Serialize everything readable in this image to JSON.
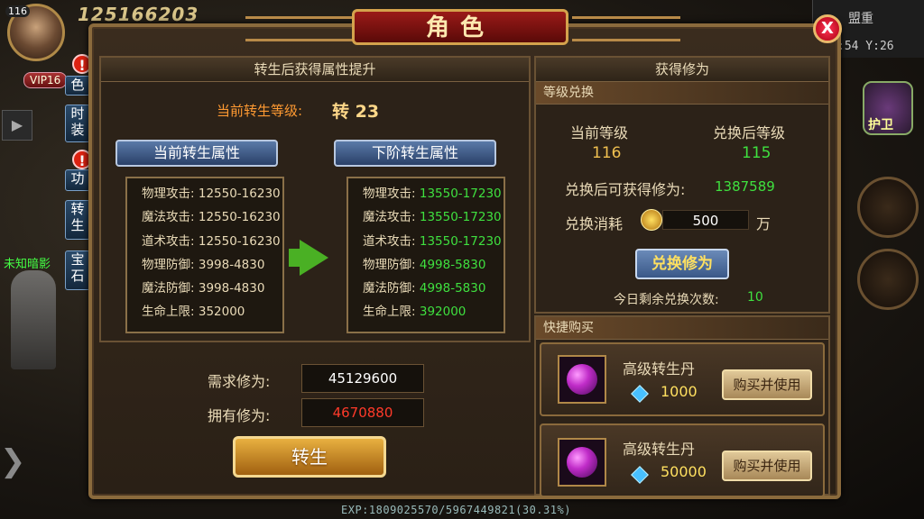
{
  "hud": {
    "player_level": "116",
    "vip": "VIP16",
    "power_value": "125166203",
    "side_tabs": [
      {
        "label": "色",
        "alert": "!"
      },
      {
        "label": "时装",
        "alert": ""
      },
      {
        "label": "功",
        "alert": "!"
      },
      {
        "label": "转生",
        "alert": ""
      },
      {
        "label": "宝石",
        "alert": ""
      }
    ],
    "npc_name": "未知暗影",
    "union": "盟重",
    "coords": ":54 Y:26",
    "guard_label": "护卫",
    "exp": "EXP:1809025570/5967449821(30.31%)"
  },
  "panel": {
    "title": "角色",
    "close": "X"
  },
  "rebirth": {
    "header": "转生后获得属性提升",
    "current_level_label": "当前转生等级:",
    "current_level_value": "转 23",
    "current_attr_title": "当前转生属性",
    "next_attr_title": "下阶转生属性",
    "current_stats": [
      {
        "k": "物理攻击:",
        "v": "12550-16230"
      },
      {
        "k": "魔法攻击:",
        "v": "12550-16230"
      },
      {
        "k": "道术攻击:",
        "v": "12550-16230"
      },
      {
        "k": "物理防御:",
        "v": "3998-4830"
      },
      {
        "k": "魔法防御:",
        "v": "3998-4830"
      },
      {
        "k": "生命上限:",
        "v": "352000"
      }
    ],
    "next_stats": [
      {
        "k": "物理攻击:",
        "v": "13550-17230"
      },
      {
        "k": "魔法攻击:",
        "v": "13550-17230"
      },
      {
        "k": "道术攻击:",
        "v": "13550-17230"
      },
      {
        "k": "物理防御:",
        "v": "4998-5830"
      },
      {
        "k": "魔法防御:",
        "v": "4998-5830"
      },
      {
        "k": "生命上限:",
        "v": "392000"
      }
    ],
    "required_label": "需求修为:",
    "required_value": "45129600",
    "owned_label": "拥有修为:",
    "owned_value": "4670880",
    "rebirth_button": "转生"
  },
  "gain": {
    "header": "获得修为",
    "exchange_section": "等级兑换",
    "current_level_label": "当前等级",
    "current_level_value": "116",
    "after_level_label": "兑换后等级",
    "after_level_value": "115",
    "gain_label": "兑换后可获得修为:",
    "gain_value": "1387589",
    "cost_label": "兑换消耗",
    "cost_value": "500",
    "cost_unit": "万",
    "exchange_button": "兑换修为",
    "today_label": "今日剩余兑换次数:",
    "today_value": "10",
    "quick_buy_section": "快捷购买",
    "items": [
      {
        "name": "高级转生丹",
        "price": "1000",
        "button": "购买并使用"
      },
      {
        "name": "高级转生丹",
        "price": "50000",
        "button": "购买并使用"
      }
    ]
  }
}
